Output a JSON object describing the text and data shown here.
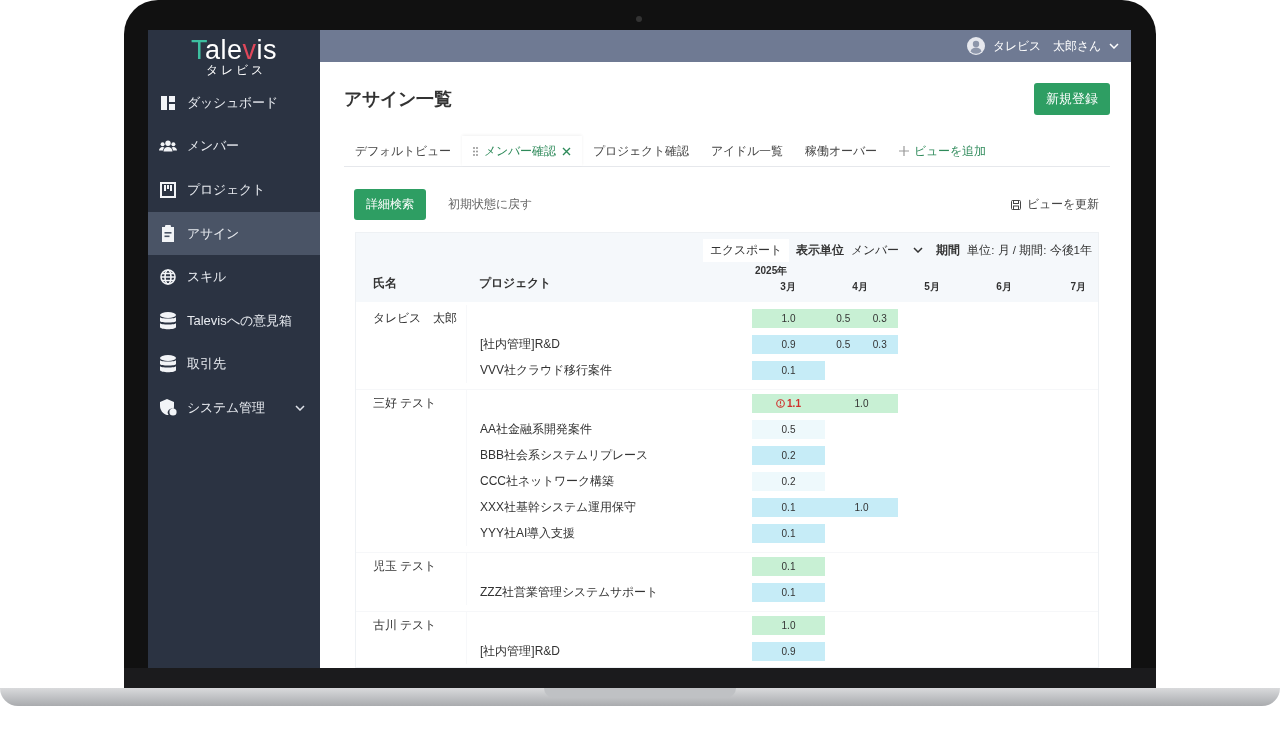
{
  "logo": {
    "parts": [
      {
        "text": "T",
        "color": "#3dbfa0"
      },
      {
        "text": "ale",
        "color": "#ffffff"
      },
      {
        "text": "v",
        "color": "#e0475a"
      },
      {
        "text": "is",
        "color": "#ffffff"
      }
    ],
    "sub": "タレビス"
  },
  "sidebar": {
    "items": [
      {
        "label": "ダッシュボード",
        "kind": "dashboard",
        "selected": false,
        "has_submenu": false
      },
      {
        "label": "メンバー",
        "kind": "people",
        "selected": false,
        "has_submenu": false
      },
      {
        "label": "プロジェクト",
        "kind": "board",
        "selected": false,
        "has_submenu": false
      },
      {
        "label": "アサイン",
        "kind": "clipboard",
        "selected": true,
        "has_submenu": false
      },
      {
        "label": "スキル",
        "kind": "globe",
        "selected": false,
        "has_submenu": false
      },
      {
        "label": "Talevisへの意見箱",
        "kind": "database",
        "selected": false,
        "has_submenu": false
      },
      {
        "label": "取引先",
        "kind": "database",
        "selected": false,
        "has_submenu": false
      },
      {
        "label": "システム管理",
        "kind": "shield",
        "selected": false,
        "has_submenu": true
      }
    ]
  },
  "topbar": {
    "user": "タレビス　太郎さん"
  },
  "page": {
    "title": "アサイン一覧",
    "new_button": "新規登録"
  },
  "tabs": [
    {
      "label": "デフォルトビュー",
      "selected": false,
      "closable": false
    },
    {
      "label": "メンバー確認",
      "selected": true,
      "closable": true
    },
    {
      "label": "プロジェクト確認",
      "selected": false,
      "closable": false
    },
    {
      "label": "アイドル一覧",
      "selected": false,
      "closable": false
    },
    {
      "label": "稼働オーバー",
      "selected": false,
      "closable": false
    }
  ],
  "add_view": "ビューを追加",
  "toolbar": {
    "search_button": "詳細検索",
    "reset_link": "初期状態に戻す",
    "update_view": "ビューを更新"
  },
  "table": {
    "export": "エクスポート",
    "unit_label": "表示単位",
    "unit_value": "メンバー",
    "period_label": "期間",
    "period_value": "単位: 月 / 期間: 今後1年",
    "columns": [
      "氏名",
      "プロジェクト"
    ],
    "year": "2025年",
    "months": [
      "3月",
      "4月",
      "5月",
      "6月",
      "7月"
    ],
    "groups": [
      {
        "member": "タレビス　太郎",
        "cells": [
          {
            "value": "1.0",
            "kind": "month",
            "alert": false
          },
          {
            "value": "0.5",
            "kind": "half",
            "alert": false
          },
          {
            "value": "0.3",
            "kind": "half",
            "alert": false
          }
        ],
        "projects": [
          {
            "name": "[社内管理]R&D",
            "color": "#c6ecf7",
            "cells": [
              {
                "value": "0.9",
                "kind": "month",
                "alert": false
              },
              {
                "value": "0.5",
                "kind": "half",
                "alert": false
              },
              {
                "value": "0.3",
                "kind": "half",
                "alert": false
              }
            ]
          },
          {
            "name": "VVV社クラウド移行案件",
            "color": "#c6ecf7",
            "cells": [
              {
                "value": "0.1",
                "kind": "month",
                "alert": false
              }
            ]
          }
        ]
      },
      {
        "member": "三好 テスト",
        "cells": [
          {
            "value": "1.1",
            "kind": "month",
            "alert": true
          },
          {
            "value": "1.0",
            "kind": "month",
            "alert": false
          }
        ],
        "projects": [
          {
            "name": "AA社金融系開発案件",
            "color": "#eef9fc",
            "cells": [
              {
                "value": "0.5",
                "kind": "month",
                "alert": false
              }
            ]
          },
          {
            "name": "BBB社会系システムリプレース",
            "color": "#c6ecf7",
            "cells": [
              {
                "value": "0.2",
                "kind": "month",
                "alert": false
              }
            ]
          },
          {
            "name": "CCC社ネットワーク構築",
            "color": "#eef9fc",
            "cells": [
              {
                "value": "0.2",
                "kind": "month",
                "alert": false
              }
            ]
          },
          {
            "name": "XXX社基幹システム運用保守",
            "color": "#c6ecf7",
            "cells": [
              {
                "value": "0.1",
                "kind": "month",
                "alert": false
              },
              {
                "value": "1.0",
                "kind": "month",
                "alert": false
              }
            ]
          },
          {
            "name": "YYY社AI導入支援",
            "color": "#c6ecf7",
            "cells": [
              {
                "value": "0.1",
                "kind": "month",
                "alert": false
              }
            ]
          }
        ]
      },
      {
        "member": "児玉 テスト",
        "cells": [
          {
            "value": "0.1",
            "kind": "month",
            "alert": false
          }
        ],
        "projects": [
          {
            "name": "ZZZ社営業管理システムサポート",
            "color": "#c6ecf7",
            "cells": [
              {
                "value": "0.1",
                "kind": "month",
                "alert": false
              }
            ]
          }
        ]
      },
      {
        "member": "古川 テスト",
        "cells": [
          {
            "value": "1.0",
            "kind": "month",
            "alert": false
          }
        ],
        "projects": [
          {
            "name": "[社内管理]R&D",
            "color": "#c6ecf7",
            "cells": [
              {
                "value": "0.9",
                "kind": "month",
                "alert": false
              }
            ]
          }
        ]
      }
    ]
  }
}
